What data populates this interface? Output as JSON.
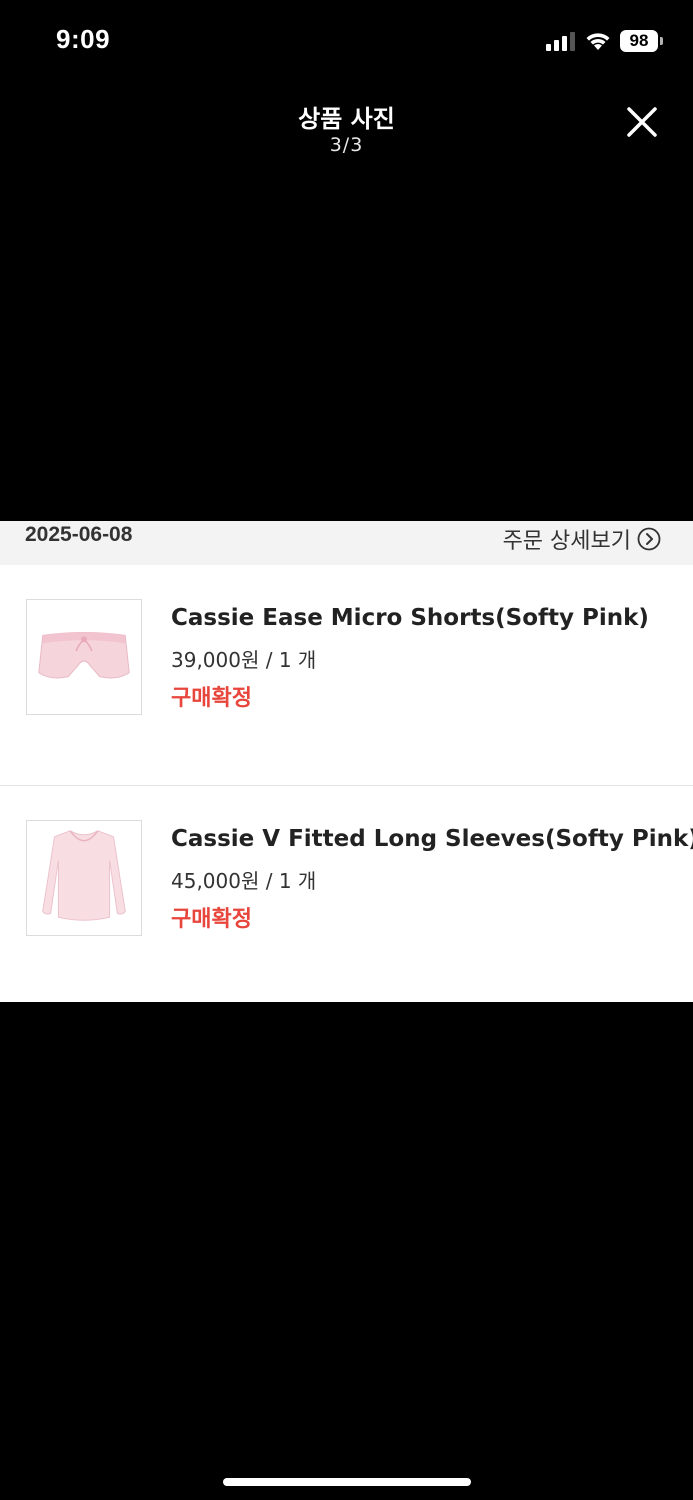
{
  "status_bar": {
    "time": "9:09",
    "battery": "98",
    "icons": [
      "signal-icon",
      "wifi-icon",
      "battery-icon"
    ]
  },
  "header": {
    "title": "상품 사진",
    "counter": "3/3",
    "close_icon": "close-icon"
  },
  "order": {
    "date": "2025-06-08",
    "detail_link": "주문 상세보기",
    "items": [
      {
        "name": "Cassie Ease Micro Shorts(Softy Pink)",
        "price": "39,000원 / 1 개",
        "status": "구매확정",
        "thumbnail": "pink-shorts-image"
      },
      {
        "name": "Cassie V Fitted Long Sleeves(Softy Pink)",
        "price": "45,000원 / 1 개",
        "status": "구매확정",
        "thumbnail": "pink-long-sleeve-image"
      }
    ]
  },
  "colors": {
    "background": "#000000",
    "status_accent": "#e8463c",
    "card_background": "#ffffff",
    "header_strip": "#f3f3f3"
  }
}
